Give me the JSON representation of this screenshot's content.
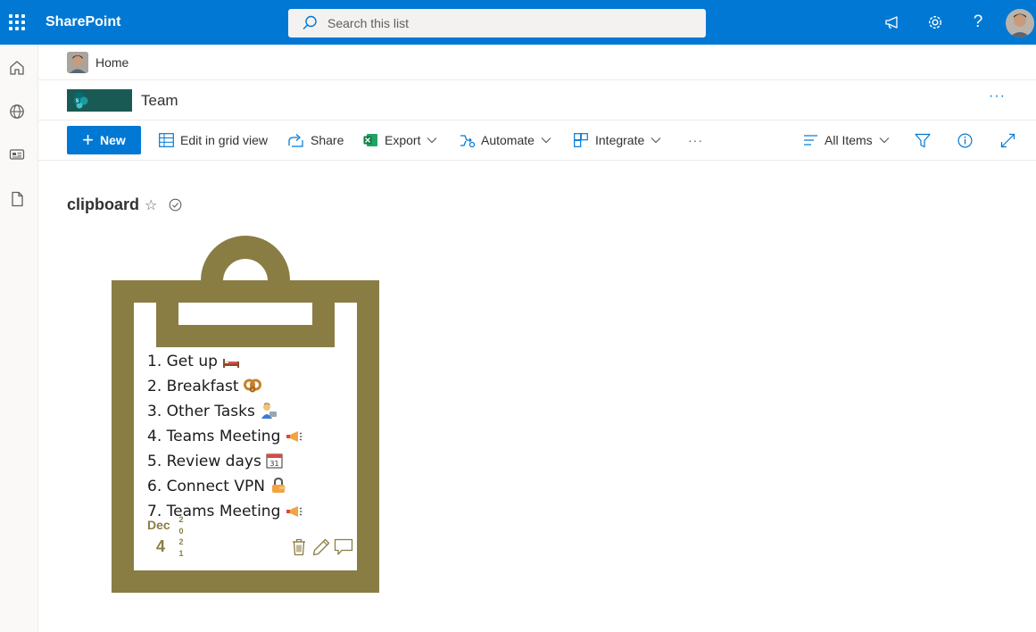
{
  "topbar": {
    "brand": "SharePoint",
    "search_placeholder": "Search this list"
  },
  "breadcrumb": {
    "home": "Home"
  },
  "site": {
    "title": "Team",
    "more": "···"
  },
  "commandbar": {
    "new_label": "New",
    "edit_grid_label": "Edit in grid view",
    "share_label": "Share",
    "export_label": "Export",
    "automate_label": "Automate",
    "integrate_label": "Integrate",
    "overflow_label": "···",
    "view_label": "All Items"
  },
  "list": {
    "title": "clipboard"
  },
  "clipboard": {
    "tasks": [
      "1. Get up",
      "2. Breakfast",
      "3. Other Tasks",
      "4. Teams Meeting",
      "5. Review days",
      "6. Connect VPN",
      "7. Teams Meeting"
    ],
    "date": {
      "month": "Dec",
      "day": "4",
      "year": "2021"
    }
  },
  "colors": {
    "accent": "#0078d4",
    "clipboard": "#8a7d44",
    "site_logo": "#1a5a54"
  }
}
